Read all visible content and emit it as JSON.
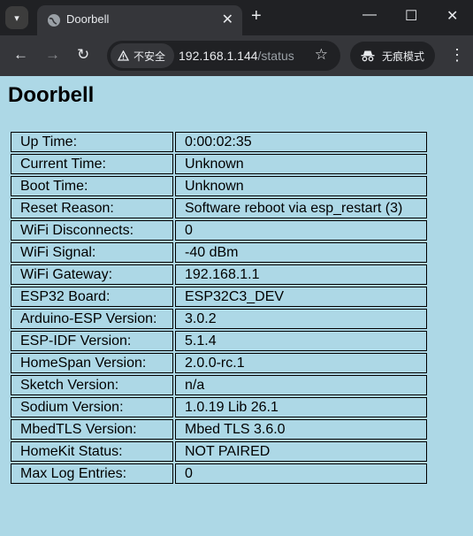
{
  "browser": {
    "tab_title": "Doorbell",
    "security_label": "不安全",
    "url_host": "192.168.1.144",
    "url_path": "/status",
    "incognito_label": "无痕模式"
  },
  "page": {
    "title": "Doorbell",
    "rows": [
      {
        "label": "Up Time:",
        "value": "0:00:02:35"
      },
      {
        "label": "Current Time:",
        "value": "Unknown"
      },
      {
        "label": "Boot Time:",
        "value": "Unknown"
      },
      {
        "label": "Reset Reason:",
        "value": "Software reboot via esp_restart (3)"
      },
      {
        "label": "WiFi Disconnects:",
        "value": "0"
      },
      {
        "label": "WiFi Signal:",
        "value": "-40 dBm"
      },
      {
        "label": "WiFi Gateway:",
        "value": "192.168.1.1"
      },
      {
        "label": "ESP32 Board:",
        "value": "ESP32C3_DEV"
      },
      {
        "label": "Arduino-ESP Version:",
        "value": "3.0.2"
      },
      {
        "label": "ESP-IDF Version:",
        "value": "5.1.4"
      },
      {
        "label": "HomeSpan Version:",
        "value": "2.0.0-rc.1"
      },
      {
        "label": "Sketch Version:",
        "value": "n/a"
      },
      {
        "label": "Sodium Version:",
        "value": "1.0.19 Lib 26.1"
      },
      {
        "label": "MbedTLS Version:",
        "value": "Mbed TLS 3.6.0"
      },
      {
        "label": "HomeKit Status:",
        "value": "NOT PAIRED"
      },
      {
        "label": "Max Log Entries:",
        "value": "0"
      }
    ]
  },
  "colors": {
    "page_background": "#add8e6",
    "chrome_dark": "#202124",
    "chrome_toolbar": "#35363a"
  }
}
